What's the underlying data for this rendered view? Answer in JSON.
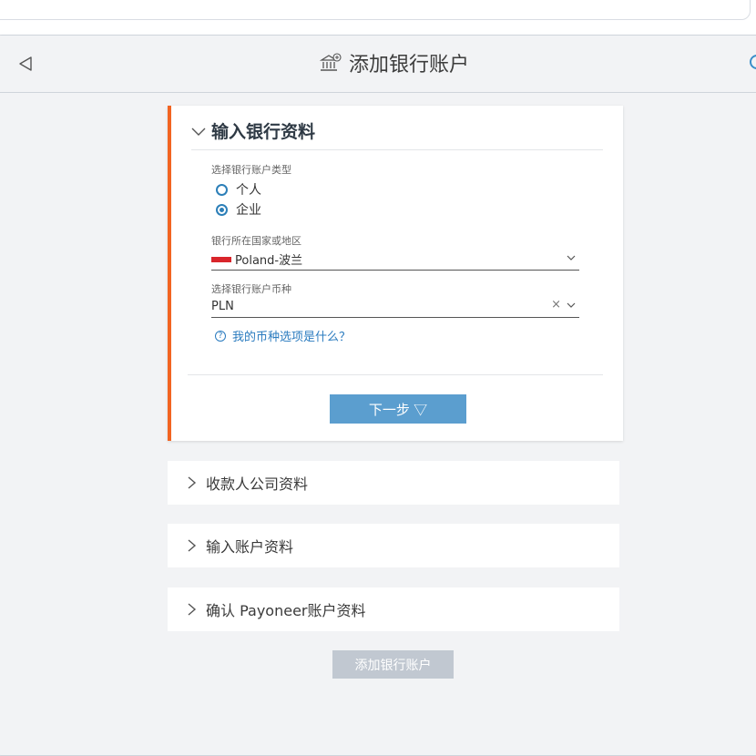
{
  "header": {
    "title": "添加银行账户",
    "back_icon": "back-triangle-icon",
    "bank_icon": "bank-add-icon",
    "help_icon": "help-circle-icon"
  },
  "section_bank_info": {
    "title": "输入银行资料",
    "expanded": true,
    "accent_color": "#f26422",
    "account_type": {
      "label": "选择银行账户类型",
      "options": [
        "个人",
        "企业"
      ],
      "selected": "企业"
    },
    "country": {
      "label": "银行所在国家或地区",
      "value": "Poland-波兰",
      "flag_icon": "poland-flag-icon"
    },
    "currency": {
      "label": "选择银行账户币种",
      "value": "PLN",
      "help_link": "我的币种选项是什么？"
    },
    "next_button": "下一步 ▽"
  },
  "collapsed_sections": [
    {
      "title": "收款人公司资料"
    },
    {
      "title": "输入账户资料"
    },
    {
      "title": "确认 Payoneer账户资料"
    }
  ],
  "add_button": "添加银行账户",
  "colors": {
    "primary_button": "#5b9ecf",
    "disabled_button": "#c1c8d1",
    "link": "#2a7bbf",
    "panel_bg": "#f2f3f5"
  }
}
